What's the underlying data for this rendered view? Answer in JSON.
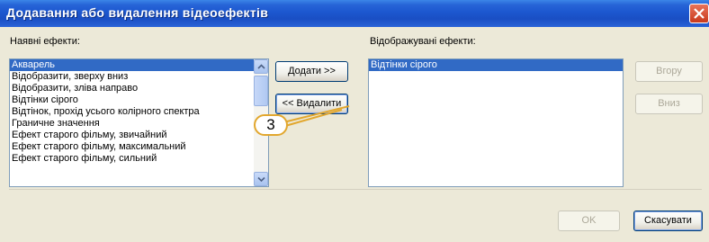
{
  "window": {
    "title": "Додавання або видалення відеоефектів"
  },
  "left_panel": {
    "label": "Наявні ефекти:",
    "items": [
      "Акварель",
      "Відобразити, зверху вниз",
      "Відобразити, зліва направо",
      "Відтінки сірого",
      "Відтінок, прохід усього колірного спектра",
      "Граничне значення",
      "Ефект старого фільму, звичайний",
      "Ефект старого фільму, максимальний",
      "Ефект старого фільму, сильний"
    ],
    "selected": "Акварель"
  },
  "middle": {
    "add_label": "Додати >>",
    "remove_label": "<< Видалити"
  },
  "right_panel": {
    "label": "Відображувані ефекти:",
    "items": [
      "Відтінки сірого"
    ],
    "selected": "Відтінки сірого"
  },
  "side_buttons": {
    "up_label": "Вгору",
    "down_label": "Вниз"
  },
  "footer": {
    "ok_label": "OK",
    "cancel_label": "Скасувати"
  },
  "annotation": {
    "number": "3"
  },
  "colors": {
    "titlebar": "#1c57cf",
    "selection": "#316ac5",
    "callout_border": "#e2a72e",
    "background": "#ece9d8"
  }
}
